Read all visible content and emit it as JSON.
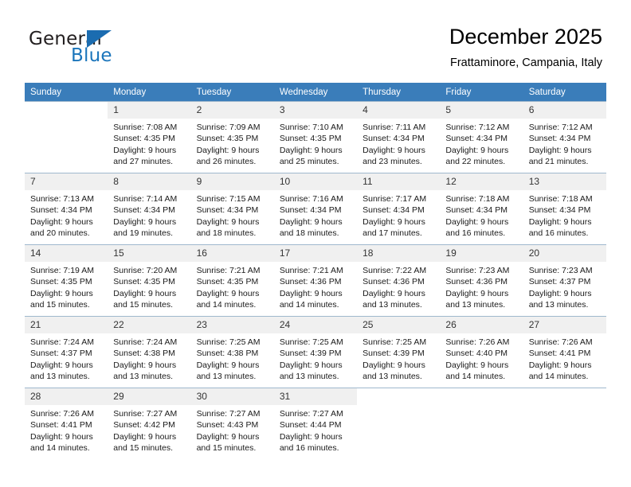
{
  "brand": {
    "line1": "General",
    "line2": "Blue",
    "flag_icon": "triangle-flag-icon",
    "colors": {
      "general": "#231f20",
      "blue": "#1b75bb",
      "flag": "#1b6cb0"
    }
  },
  "header": {
    "title": "December 2025",
    "subtitle": "Frattaminore, Campania, Italy"
  },
  "theme": {
    "header_row_bg": "#3a7dba",
    "header_row_text": "#ffffff",
    "daynum_bg": "#f0f0f0",
    "grid_line": "#b8b8b8"
  },
  "weekdays": [
    "Sunday",
    "Monday",
    "Tuesday",
    "Wednesday",
    "Thursday",
    "Friday",
    "Saturday"
  ],
  "weeks": [
    [
      {
        "day": "",
        "info": ""
      },
      {
        "day": "1",
        "info": "Sunrise: 7:08 AM\nSunset: 4:35 PM\nDaylight: 9 hours\nand 27 minutes."
      },
      {
        "day": "2",
        "info": "Sunrise: 7:09 AM\nSunset: 4:35 PM\nDaylight: 9 hours\nand 26 minutes."
      },
      {
        "day": "3",
        "info": "Sunrise: 7:10 AM\nSunset: 4:35 PM\nDaylight: 9 hours\nand 25 minutes."
      },
      {
        "day": "4",
        "info": "Sunrise: 7:11 AM\nSunset: 4:34 PM\nDaylight: 9 hours\nand 23 minutes."
      },
      {
        "day": "5",
        "info": "Sunrise: 7:12 AM\nSunset: 4:34 PM\nDaylight: 9 hours\nand 22 minutes."
      },
      {
        "day": "6",
        "info": "Sunrise: 7:12 AM\nSunset: 4:34 PM\nDaylight: 9 hours\nand 21 minutes."
      }
    ],
    [
      {
        "day": "7",
        "info": "Sunrise: 7:13 AM\nSunset: 4:34 PM\nDaylight: 9 hours\nand 20 minutes."
      },
      {
        "day": "8",
        "info": "Sunrise: 7:14 AM\nSunset: 4:34 PM\nDaylight: 9 hours\nand 19 minutes."
      },
      {
        "day": "9",
        "info": "Sunrise: 7:15 AM\nSunset: 4:34 PM\nDaylight: 9 hours\nand 18 minutes."
      },
      {
        "day": "10",
        "info": "Sunrise: 7:16 AM\nSunset: 4:34 PM\nDaylight: 9 hours\nand 18 minutes."
      },
      {
        "day": "11",
        "info": "Sunrise: 7:17 AM\nSunset: 4:34 PM\nDaylight: 9 hours\nand 17 minutes."
      },
      {
        "day": "12",
        "info": "Sunrise: 7:18 AM\nSunset: 4:34 PM\nDaylight: 9 hours\nand 16 minutes."
      },
      {
        "day": "13",
        "info": "Sunrise: 7:18 AM\nSunset: 4:34 PM\nDaylight: 9 hours\nand 16 minutes."
      }
    ],
    [
      {
        "day": "14",
        "info": "Sunrise: 7:19 AM\nSunset: 4:35 PM\nDaylight: 9 hours\nand 15 minutes."
      },
      {
        "day": "15",
        "info": "Sunrise: 7:20 AM\nSunset: 4:35 PM\nDaylight: 9 hours\nand 15 minutes."
      },
      {
        "day": "16",
        "info": "Sunrise: 7:21 AM\nSunset: 4:35 PM\nDaylight: 9 hours\nand 14 minutes."
      },
      {
        "day": "17",
        "info": "Sunrise: 7:21 AM\nSunset: 4:36 PM\nDaylight: 9 hours\nand 14 minutes."
      },
      {
        "day": "18",
        "info": "Sunrise: 7:22 AM\nSunset: 4:36 PM\nDaylight: 9 hours\nand 13 minutes."
      },
      {
        "day": "19",
        "info": "Sunrise: 7:23 AM\nSunset: 4:36 PM\nDaylight: 9 hours\nand 13 minutes."
      },
      {
        "day": "20",
        "info": "Sunrise: 7:23 AM\nSunset: 4:37 PM\nDaylight: 9 hours\nand 13 minutes."
      }
    ],
    [
      {
        "day": "21",
        "info": "Sunrise: 7:24 AM\nSunset: 4:37 PM\nDaylight: 9 hours\nand 13 minutes."
      },
      {
        "day": "22",
        "info": "Sunrise: 7:24 AM\nSunset: 4:38 PM\nDaylight: 9 hours\nand 13 minutes."
      },
      {
        "day": "23",
        "info": "Sunrise: 7:25 AM\nSunset: 4:38 PM\nDaylight: 9 hours\nand 13 minutes."
      },
      {
        "day": "24",
        "info": "Sunrise: 7:25 AM\nSunset: 4:39 PM\nDaylight: 9 hours\nand 13 minutes."
      },
      {
        "day": "25",
        "info": "Sunrise: 7:25 AM\nSunset: 4:39 PM\nDaylight: 9 hours\nand 13 minutes."
      },
      {
        "day": "26",
        "info": "Sunrise: 7:26 AM\nSunset: 4:40 PM\nDaylight: 9 hours\nand 14 minutes."
      },
      {
        "day": "27",
        "info": "Sunrise: 7:26 AM\nSunset: 4:41 PM\nDaylight: 9 hours\nand 14 minutes."
      }
    ],
    [
      {
        "day": "28",
        "info": "Sunrise: 7:26 AM\nSunset: 4:41 PM\nDaylight: 9 hours\nand 14 minutes."
      },
      {
        "day": "29",
        "info": "Sunrise: 7:27 AM\nSunset: 4:42 PM\nDaylight: 9 hours\nand 15 minutes."
      },
      {
        "day": "30",
        "info": "Sunrise: 7:27 AM\nSunset: 4:43 PM\nDaylight: 9 hours\nand 15 minutes."
      },
      {
        "day": "31",
        "info": "Sunrise: 7:27 AM\nSunset: 4:44 PM\nDaylight: 9 hours\nand 16 minutes."
      },
      {
        "day": "",
        "info": ""
      },
      {
        "day": "",
        "info": ""
      },
      {
        "day": "",
        "info": ""
      }
    ]
  ]
}
